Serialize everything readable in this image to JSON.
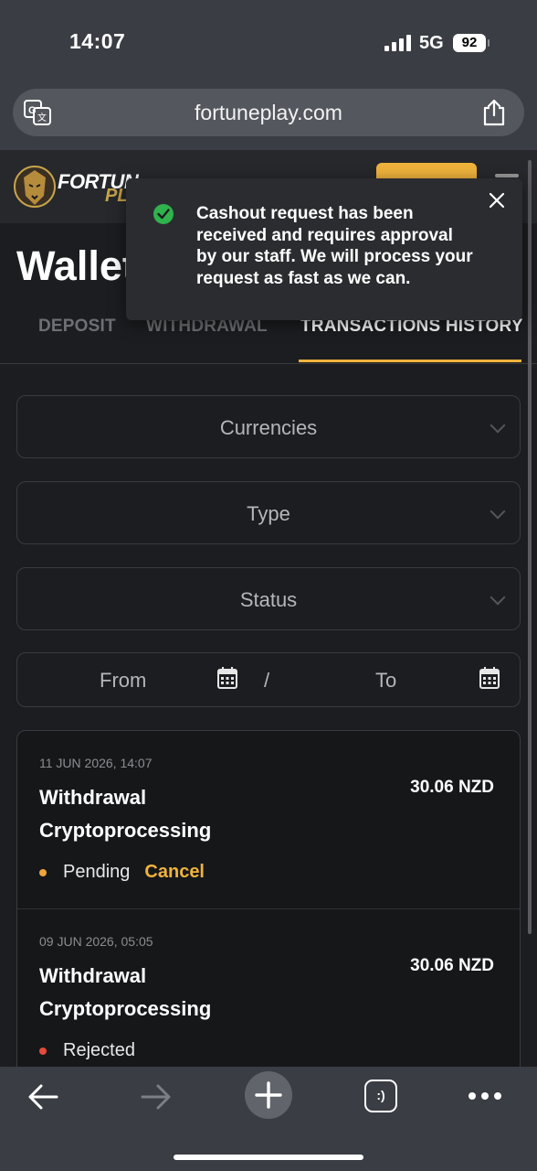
{
  "status_bar": {
    "time": "14:07",
    "network": "5G",
    "battery": "92"
  },
  "browser": {
    "url": "fortuneplay.com"
  },
  "site": {
    "logo_text": "FORTUN",
    "logo_sub": "PL",
    "page_title": "Wallet"
  },
  "tabs": [
    {
      "label": "DEPOSIT"
    },
    {
      "label": "WITHDRAWAL"
    },
    {
      "label": "TRANSACTIONS HISTORY"
    }
  ],
  "filters": {
    "currencies": "Currencies",
    "type": "Type",
    "status": "Status",
    "from": "From",
    "separator": "/",
    "to": "To"
  },
  "transactions": [
    {
      "date": "11 JUN 2026, 14:07",
      "title_line1": "Withdrawal",
      "title_line2": "Cryptoprocessing",
      "amount": "30.06 NZD",
      "status": "Pending",
      "status_color": "#f0a43c",
      "action": "Cancel"
    },
    {
      "date": "09 JUN 2026, 05:05",
      "title_line1": "Withdrawal",
      "title_line2": "Cryptoprocessing",
      "amount": "30.06 NZD",
      "status": "Rejected",
      "status_color": "#e84a3b"
    }
  ],
  "toast": {
    "message": "Cashout request has been received and requires approval by our staff. We will process your request as fast as we can."
  },
  "toolbar": {
    "tabs_label": ":)"
  },
  "colors": {
    "accent": "#f0b33c",
    "success": "#2fb34c"
  }
}
